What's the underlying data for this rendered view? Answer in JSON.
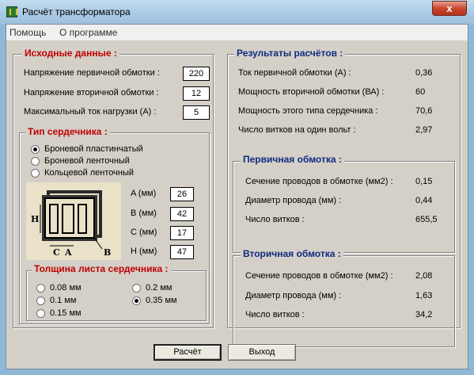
{
  "window": {
    "title": "Расчёт трансформатора",
    "close_glyph": "x"
  },
  "menu": {
    "help": "Помощь",
    "about": "О программе"
  },
  "input": {
    "title": "Исходные данные :",
    "primary_voltage_label": "Напряжение первичной обмотки :",
    "primary_voltage_value": "220",
    "secondary_voltage_label": "Напряжение вторичной обмотки :",
    "secondary_voltage_value": "12",
    "max_current_label": "Максимальный ток нагрузки  (А)  :",
    "max_current_value": "5"
  },
  "core": {
    "title": "Тип сердечника :",
    "types": [
      "Броневой пластинчатый",
      "Броневой ленточный",
      "Кольцевой ленточный"
    ],
    "selected_type": 0,
    "diagram_letters": [
      "H",
      "C",
      "A",
      "B"
    ],
    "dims": [
      {
        "label": "A (мм)",
        "value": "26"
      },
      {
        "label": "B (мм)",
        "value": "42"
      },
      {
        "label": "C (мм)",
        "value": "17"
      },
      {
        "label": "H (мм)",
        "value": "47"
      }
    ]
  },
  "thickness": {
    "title": "Толщина листа сердечника :",
    "options": [
      "0.08 мм",
      "0.1 мм",
      "0.15 мм",
      "0.2 мм",
      "0.35 мм"
    ],
    "selected": 4
  },
  "results": {
    "title": "Результаты расчётов :",
    "rows": [
      {
        "label": "Ток первичной обмотки (А) :",
        "value": "0,36"
      },
      {
        "label": "Мощность вторичной обмотки (ВА) :",
        "value": "60"
      },
      {
        "label": "Мощность  этого типа сердечника :",
        "value": "70,6"
      },
      {
        "label": "Число витков на один вольт :",
        "value": "2,97"
      }
    ],
    "primary": {
      "title": "Первичная обмотка :",
      "rows": [
        {
          "label": "Сечение проводов в обмотке (мм2) :",
          "value": "0,15"
        },
        {
          "label": "Диаметр провода (мм) :",
          "value": "0,44"
        },
        {
          "label": "Число витков :",
          "value": "655,5"
        }
      ]
    },
    "secondary": {
      "title": "Вторичная обмотка :",
      "rows": [
        {
          "label": "Сечение проводов в обмотке (мм2) :",
          "value": "2,08"
        },
        {
          "label": "Диаметр провода (мм) :",
          "value": "1,63"
        },
        {
          "label": "Число витков :",
          "value": "34,2"
        }
      ]
    }
  },
  "buttons": {
    "calc": "Расчёт",
    "exit": "Выход"
  }
}
